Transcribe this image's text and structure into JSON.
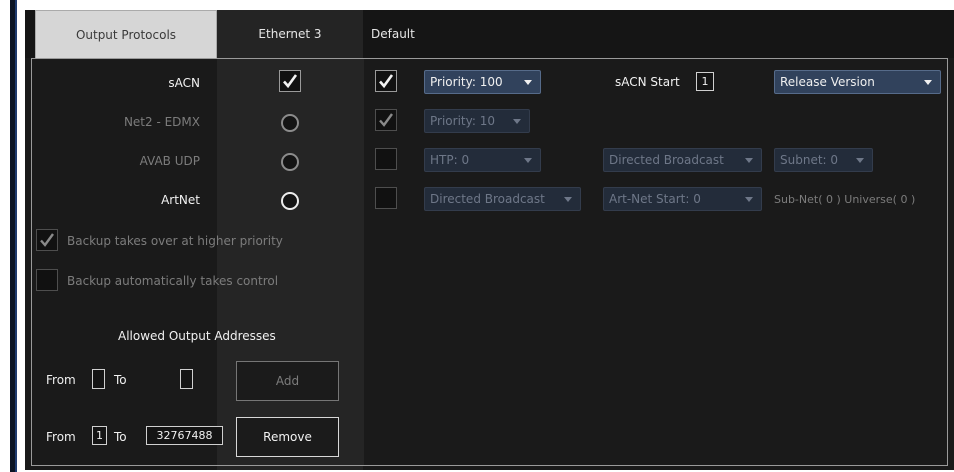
{
  "tabs": {
    "output_protocols": "Output Protocols",
    "ethernet": "Ethernet 3",
    "default": "Default"
  },
  "protocols": {
    "sacn": {
      "label": "sACN",
      "enabled": true,
      "default_checked": true,
      "priority": "Priority: 100",
      "start_label": "sACN Start",
      "start_value": "1",
      "version": "Release Version"
    },
    "net2": {
      "label": "Net2 - EDMX",
      "enabled": false,
      "default_checked": true,
      "priority": "Priority: 10"
    },
    "avab": {
      "label": "AVAB UDP",
      "enabled": false,
      "default_checked": false,
      "htp": "HTP: 0",
      "broadcast": "Directed Broadcast",
      "subnet": "Subnet: 0"
    },
    "artnet": {
      "label": "ArtNet",
      "enabled": true,
      "default_checked": false,
      "broadcast": "Directed Broadcast",
      "start": "Art-Net Start: 0",
      "subnet_universe": "Sub-Net( 0 ) Universe( 0 )"
    }
  },
  "options": {
    "backup_higher_priority": {
      "label": "Backup takes over at higher priority",
      "checked": true
    },
    "backup_auto_control": {
      "label": "Backup automatically takes control",
      "checked": false
    }
  },
  "addresses": {
    "title": "Allowed Output Addresses",
    "from_label": "From",
    "to_label": "To",
    "row1": {
      "from": "",
      "to": "",
      "button": "Add"
    },
    "row2": {
      "from": "1",
      "to": "32767488",
      "button": "Remove"
    }
  },
  "colors": {
    "panel_bg": "#1a1a1a",
    "dropdown_bg": "#31425c",
    "active_tab_bg": "#d6d6d6",
    "side_bar": "#0b1424"
  }
}
